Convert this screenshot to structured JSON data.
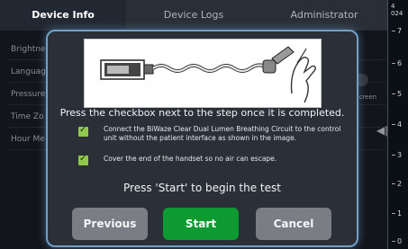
{
  "tabs": [
    {
      "label": "Device Info",
      "active": true
    },
    {
      "label": "Device Logs",
      "active": false
    },
    {
      "label": "Administrator",
      "active": false
    }
  ],
  "background_rows": [
    "Brightne",
    "Languag",
    "Pressure",
    "Time Zo",
    "Hour Me"
  ],
  "background_right": {
    "screen_label": "Screen"
  },
  "scale": {
    "top_label": "4\n024",
    "ticks": [
      "7",
      "6",
      "5",
      "4",
      "3",
      "2",
      "1",
      "0"
    ]
  },
  "modal": {
    "illustration_icon": "breathing-circuit-handset-illustration",
    "instruction": "Press the checkbox next to the step once it is completed.",
    "steps": [
      {
        "text": "Connect the BiWaze Clear Dual Lumen Breathing Circuit to the control unit without the patient interface as shown in the image.",
        "checked": true
      },
      {
        "text": "Cover the end of the handset so no air can escape.",
        "checked": true
      }
    ],
    "press_text": "Press 'Start' to begin the test",
    "buttons": {
      "previous": "Previous",
      "start": "Start",
      "cancel": "Cancel"
    }
  },
  "colors": {
    "modal_border": "#6fa0c8",
    "start_button": "#0d9a33",
    "secondary_button": "#7a7e84",
    "checkbox": "#8fc84a"
  }
}
